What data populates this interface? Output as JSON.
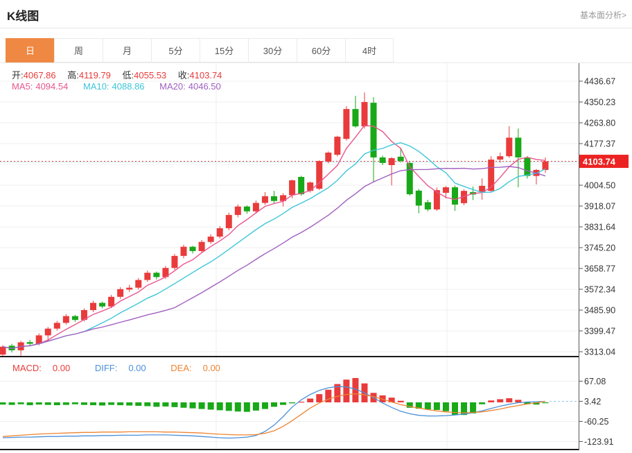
{
  "header": {
    "title": "K线图",
    "link": "基本面分析>"
  },
  "tabs": {
    "items": [
      {
        "label": "日",
        "active": true
      },
      {
        "label": "周",
        "active": false
      },
      {
        "label": "月",
        "active": false
      },
      {
        "label": "5分",
        "active": false
      },
      {
        "label": "15分",
        "active": false
      },
      {
        "label": "30分",
        "active": false
      },
      {
        "label": "60分",
        "active": false
      },
      {
        "label": "4时",
        "active": false
      }
    ]
  },
  "ohlc_legend": {
    "open_label": "开:",
    "open": "4067.86",
    "high_label": "高:",
    "high": "4119.79",
    "low_label": "低:",
    "low": "4055.53",
    "close_label": "收:",
    "close": "4103.74"
  },
  "ma_legend": {
    "ma5_label": "MA5:",
    "ma5": "4094.54",
    "ma10_label": "MA10:",
    "ma10": "4088.86",
    "ma20_label": "MA20:",
    "ma20": "4046.50"
  },
  "macd_legend": {
    "macd_label": "MACD:",
    "macd": "0.00",
    "diff_label": "DIFF:",
    "diff": "0.00",
    "dea_label": "DEA:",
    "dea": "0.00"
  },
  "colors": {
    "up": "#e93b3b",
    "down": "#18a818",
    "ma5": "#e8558e",
    "ma10": "#3ec6d9",
    "ma20": "#a05fc0",
    "diff": "#4a90d9",
    "dea": "#ee8432",
    "tab_active_bg": "#ef8843",
    "price_tag_bg": "#ec2323",
    "price_line": "#e53935",
    "axis_text": "#333333",
    "grid": "#efefef"
  },
  "chart_data": {
    "type": "candlestick_with_macd",
    "title": "K线图",
    "timeframe": "日",
    "current_price": 4103.74,
    "current_price_label": "4103.74",
    "y_axis": {
      "labels": [
        "4436.67",
        "4350.23",
        "4263.80",
        "4177.37",
        "4004.50",
        "3918.07",
        "3831.64",
        "3745.20",
        "3658.77",
        "3572.34",
        "3485.90",
        "3399.47",
        "3313.04"
      ],
      "tick_step": 86.43,
      "grid_top_value": 4436.67,
      "grid_lines": 14
    },
    "macd_axis": {
      "labels": [
        "67.08",
        "3.42",
        "-60.25",
        "-123.91"
      ]
    },
    "ohlc": {
      "open": 4067.86,
      "high": 4119.79,
      "low": 4055.53,
      "close": 4103.74
    },
    "ma_values": {
      "ma5": 4094.54,
      "ma10": 4088.86,
      "ma20": 4046.5
    },
    "ma_periods": [
      5,
      10,
      20
    ],
    "candles": [
      [
        3301,
        3340,
        3292,
        3334
      ],
      [
        3338,
        3346,
        3310,
        3319
      ],
      [
        3319,
        3358,
        3297,
        3352
      ],
      [
        3353,
        3362,
        3338,
        3346
      ],
      [
        3346,
        3389,
        3339,
        3381
      ],
      [
        3381,
        3416,
        3357,
        3409
      ],
      [
        3409,
        3441,
        3401,
        3433
      ],
      [
        3433,
        3469,
        3426,
        3461
      ],
      [
        3461,
        3466,
        3437,
        3445
      ],
      [
        3445,
        3493,
        3439,
        3486
      ],
      [
        3486,
        3525,
        3478,
        3516
      ],
      [
        3516,
        3521,
        3493,
        3501
      ],
      [
        3501,
        3549,
        3494,
        3541
      ],
      [
        3541,
        3581,
        3533,
        3573
      ],
      [
        3571,
        3591,
        3561,
        3579
      ],
      [
        3579,
        3619,
        3571,
        3611
      ],
      [
        3611,
        3651,
        3603,
        3641
      ],
      [
        3641,
        3646,
        3613,
        3623
      ],
      [
        3623,
        3669,
        3616,
        3661
      ],
      [
        3661,
        3719,
        3653,
        3711
      ],
      [
        3711,
        3757,
        3701,
        3749
      ],
      [
        3749,
        3753,
        3721,
        3731
      ],
      [
        3731,
        3777,
        3723,
        3769
      ],
      [
        3769,
        3801,
        3761,
        3791
      ],
      [
        3791,
        3835,
        3783,
        3826
      ],
      [
        3826,
        3891,
        3817,
        3881
      ],
      [
        3881,
        3925,
        3871,
        3916
      ],
      [
        3916,
        3921,
        3886,
        3896
      ],
      [
        3896,
        3941,
        3887,
        3931
      ],
      [
        3931,
        3976,
        3923,
        3959
      ],
      [
        3959,
        3981,
        3929,
        3939
      ],
      [
        3939,
        3971,
        3916,
        3963
      ],
      [
        3963,
        4028,
        3950,
        4025
      ],
      [
        4039,
        4044,
        3961,
        3967
      ],
      [
        3981,
        4020,
        3974,
        4016
      ],
      [
        3990,
        4108,
        3984,
        4105
      ],
      [
        4102,
        4145,
        4095,
        4140
      ],
      [
        4131,
        4210,
        4124,
        4206
      ],
      [
        4197,
        4333,
        4190,
        4321
      ],
      [
        4321,
        4376,
        4243,
        4249
      ],
      [
        4249,
        4390,
        4240,
        4350
      ],
      [
        4347,
        4370,
        4016,
        4120
      ],
      [
        4120,
        4128,
        4088,
        4097
      ],
      [
        4088,
        4121,
        4004,
        4117
      ],
      [
        4123,
        4160,
        4099,
        4105
      ],
      [
        4097,
        4102,
        3961,
        3967
      ],
      [
        3982,
        3989,
        3888,
        3920
      ],
      [
        3934,
        3944,
        3896,
        3904
      ],
      [
        3904,
        3995,
        3898,
        3984
      ],
      [
        3973,
        4001,
        3950,
        3996
      ],
      [
        3996,
        4003,
        3898,
        3924
      ],
      [
        3930,
        3988,
        3922,
        3981
      ],
      [
        3976,
        3999,
        3943,
        3966
      ],
      [
        3976,
        4033,
        3944,
        4002
      ],
      [
        3981,
        4125,
        3974,
        4111
      ],
      [
        4111,
        4140,
        4098,
        4125
      ],
      [
        4125,
        4250,
        4118,
        4202
      ],
      [
        4202,
        4240,
        3996,
        4120
      ],
      [
        4120,
        4126,
        4032,
        4043
      ],
      [
        4043,
        4072,
        4008,
        4068
      ],
      [
        4067.86,
        4119.79,
        4055.53,
        4103.74
      ]
    ],
    "macd": {
      "hist": [
        -7,
        -8,
        -6,
        -9,
        -7,
        -8,
        -9,
        -8,
        -6,
        -8,
        -9,
        -10,
        -8,
        -9,
        -10,
        -11,
        -12,
        -14,
        -13,
        -15,
        -17,
        -19,
        -21,
        -23,
        -25,
        -27,
        -29,
        -30,
        -26,
        -21,
        -14,
        -8,
        -3,
        2,
        12,
        26,
        40,
        58,
        72,
        77,
        60,
        30,
        22,
        15,
        5,
        -17,
        -20,
        -22,
        -24,
        -28,
        -40,
        -40,
        -35,
        -6,
        6,
        10,
        13,
        8,
        -6,
        -7,
        -2
      ],
      "diff": [
        -112,
        -111,
        -110,
        -110,
        -109,
        -108,
        -108,
        -107,
        -107,
        -106,
        -106,
        -105,
        -105,
        -104,
        -104,
        -104,
        -103,
        -103,
        -103,
        -104,
        -105,
        -106,
        -108,
        -110,
        -112,
        -113,
        -112,
        -110,
        -105,
        -92,
        -72,
        -45,
        -15,
        8,
        25,
        38,
        46,
        50,
        49,
        42,
        30,
        15,
        -2,
        -16,
        -28,
        -36,
        -41,
        -43,
        -43,
        -42,
        -40,
        -37,
        -33,
        -27,
        -19,
        -12,
        -6,
        -1,
        1,
        2,
        3.4
      ],
      "dea": [
        -108,
        -106,
        -104,
        -102,
        -100,
        -99,
        -98,
        -97,
        -96,
        -95,
        -95,
        -94,
        -94,
        -94,
        -93,
        -93,
        -93,
        -93,
        -94,
        -94,
        -95,
        -96,
        -97,
        -99,
        -101,
        -102,
        -103,
        -103,
        -102,
        -98,
        -90,
        -76,
        -58,
        -38,
        -18,
        -2,
        10,
        19,
        25,
        27,
        24,
        18,
        10,
        1,
        -7,
        -13,
        -18,
        -23,
        -27,
        -30,
        -32,
        -33,
        -32,
        -30,
        -26,
        -21,
        -15,
        -10,
        -5,
        -1,
        3.4
      ]
    }
  }
}
